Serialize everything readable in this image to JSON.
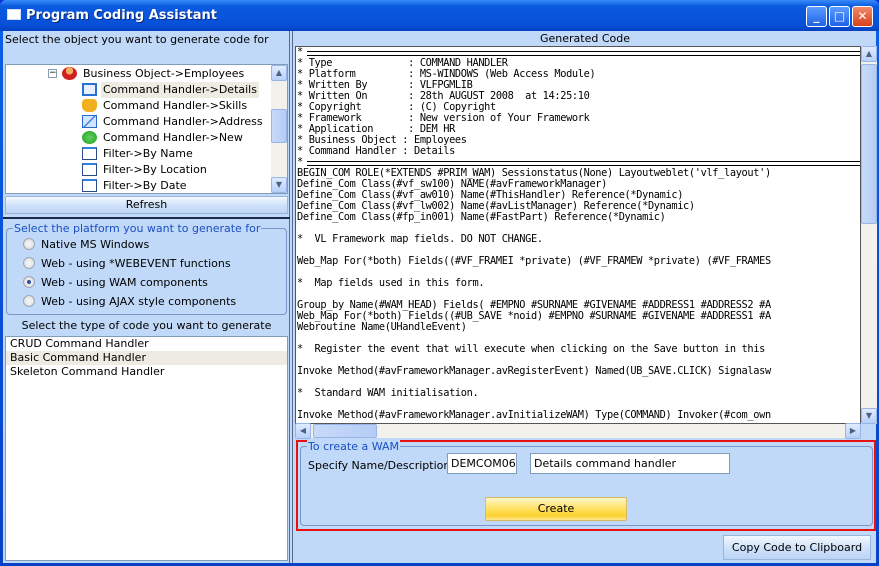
{
  "window": {
    "title": "Program Coding Assistant",
    "controls": [
      "minimize",
      "maximize",
      "close"
    ]
  },
  "left": {
    "object_prompt": "Select the object you want to generate code for",
    "tree": [
      {
        "label": "Business Object->Employees",
        "icon": "person-icon",
        "expander": "minus",
        "level": 0
      },
      {
        "label": "Command Handler->Details",
        "icon": "window-icon",
        "level": 1,
        "selected": true
      },
      {
        "label": "Command Handler->Skills",
        "icon": "hand-icon",
        "level": 1
      },
      {
        "label": "Command Handler->Address",
        "icon": "envelope-icon",
        "level": 1
      },
      {
        "label": "Command Handler->New",
        "icon": "plus-circle-icon",
        "level": 1
      },
      {
        "label": "Filter->By Name",
        "icon": "filter-window-icon",
        "level": 1
      },
      {
        "label": "Filter->By Location",
        "icon": "filter-window-icon",
        "level": 1
      },
      {
        "label": "Filter->By Date",
        "icon": "filter-window-icon",
        "level": 1
      }
    ],
    "refresh_label": "Refresh",
    "platform_group": "Select the platform you want to generate for",
    "platforms": [
      {
        "label": "Native MS Windows",
        "checked": false
      },
      {
        "label": "Web - using *WEBEVENT functions",
        "checked": false
      },
      {
        "label": "Web - using WAM components",
        "checked": true
      },
      {
        "label": "Web - using AJAX style components",
        "checked": false
      }
    ],
    "type_prompt": "Select the type of code you want to generate",
    "types": [
      {
        "label": "CRUD Command Handler",
        "selected": false
      },
      {
        "label": "Basic Command Handler",
        "selected": true
      },
      {
        "label": "Skeleton Command Handler",
        "selected": false
      }
    ]
  },
  "right": {
    "header": "Generated Code",
    "code_lines": [
      "*SEP",
      "* Type             : COMMAND HANDLER",
      "* Platform         : MS-WINDOWS (Web Access Module)",
      "* Written By       : VLFPGMLIB",
      "* Written On       : 28th AUGUST 2008  at 14:25:10",
      "* Copyright        : (C) Copyright",
      "* Framework        : New version of Your Framework",
      "* Application      : DEM HR",
      "* Business Object : Employees",
      "* Command Handler : Details",
      "*SEP",
      "BEGIN_COM ROLE(*EXTENDS #PRIM_WAM) Sessionstatus(None) Layoutweblet('vlf_layout')",
      "Define_Com Class(#vf_sw100) NAME(#avFrameworkManager)",
      "Define_Com Class(#vf_aw010) Name(#ThisHandler) Reference(*Dynamic)",
      "Define_Com Class(#vf_lw002) Name(#avListManager) Reference(*Dynamic)",
      "Define_Com Class(#fp_in001) Name(#FastPart) Reference(*Dynamic)",
      "",
      "*  VL Framework map fields. DO NOT CHANGE.",
      "",
      "Web_Map For(*both) Fields((#VF_FRAMEI *private) (#VF_FRAMEW *private) (#VF_FRAMES",
      "",
      "*  Map fields used in this form.",
      "",
      "Group_by Name(#WAM_HEAD) Fields( #EMPNO #SURNAME #GIVENAME #ADDRESS1 #ADDRESS2 #A",
      "Web_Map For(*both) Fields((#UB_SAVE *noid) #EMPNO #SURNAME #GIVENAME #ADDRESS1 #A",
      "Webroutine Name(UHandleEvent)",
      "",
      "*  Register the event that will execute when clicking on the Save button in this",
      "",
      "Invoke Method(#avFrameworkManager.avRegisterEvent) Named(UB_SAVE.CLICK) Signalasw",
      "",
      "*  Standard WAM initialisation.",
      "",
      "Invoke Method(#avFrameworkManager.avInitializeWAM) Type(COMMAND) Invoker(#com_own"
    ],
    "wam_group": "To create a WAM",
    "name_label": "Specify Name/Description",
    "name_value": "DEMCOM06",
    "description_value": "Details command handler",
    "create_label": "Create",
    "copy_label": "Copy Code to Clipboard",
    "highlight_color": "#e81010"
  }
}
